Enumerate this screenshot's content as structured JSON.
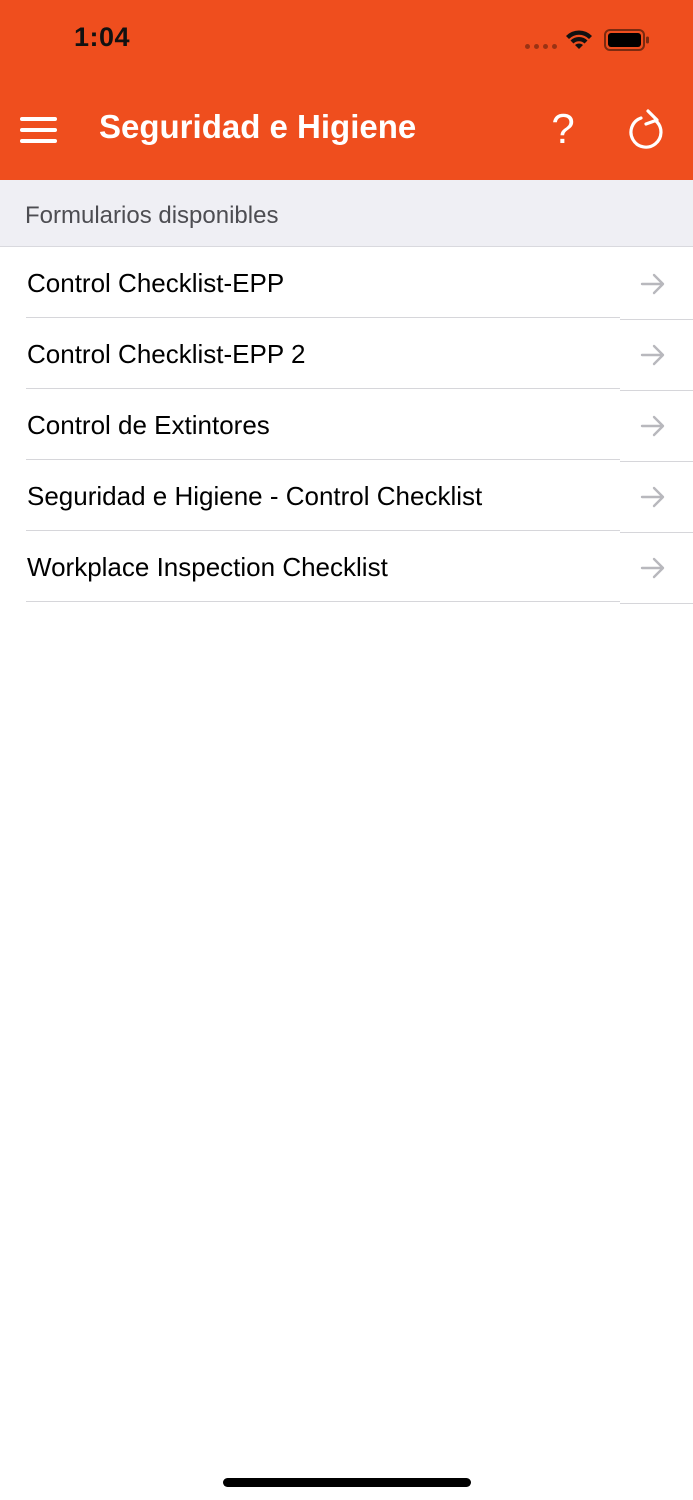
{
  "status_bar": {
    "time": "1:04",
    "wifi_icon": "wifi-icon",
    "battery_icon": "battery-icon"
  },
  "nav_bar": {
    "title": "Seguridad e Higiene",
    "menu_icon": "hamburger-menu-icon",
    "help_label": "?",
    "refresh_icon": "refresh-icon",
    "background_color": "#ef4e1e"
  },
  "section": {
    "header": "Formularios disponibles"
  },
  "forms": [
    {
      "label": "Control Checklist-EPP"
    },
    {
      "label": "Control Checklist-EPP 2"
    },
    {
      "label": "Control de Extintores"
    },
    {
      "label": "Seguridad e Higiene - Control Checklist"
    },
    {
      "label": "Workplace Inspection Checklist"
    }
  ]
}
